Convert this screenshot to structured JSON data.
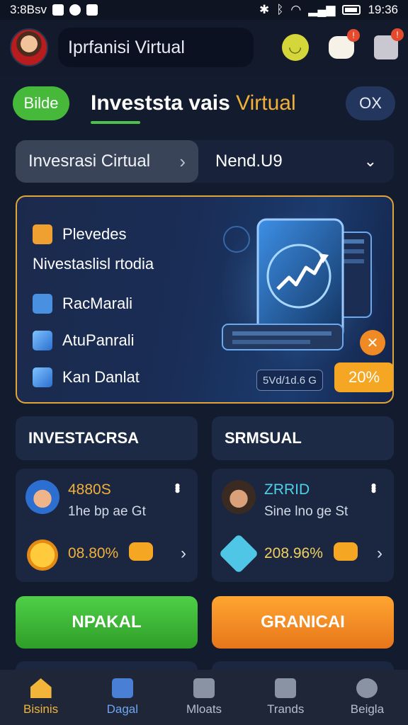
{
  "status_bar": {
    "left_text": "3:8Bsv",
    "time": "19:36"
  },
  "header": {
    "search_text": "Iprfanisi Virtual"
  },
  "title_row": {
    "pill_label": "Bilde",
    "title_main": "Investsta vais",
    "title_accent": "Virtual",
    "close_label": "OX"
  },
  "selector": {
    "left_label": "Invesrasi Cirtual",
    "left_chevron": "›",
    "right_label": "Nend.U9",
    "right_chevron": "⌄"
  },
  "hero": {
    "items": [
      {
        "label": "Plevedes",
        "icon": "tag-icon"
      },
      {
        "label": "RacMarali",
        "icon": "document-icon"
      },
      {
        "label": "AtuPanrali",
        "icon": "cube-icon"
      },
      {
        "label": "Kan Danlat",
        "icon": "cube-icon"
      }
    ],
    "subtitle": "Nivestaslisl rtodia",
    "badge_text": "5Vd/1d.6 G",
    "close_symbol": "✕",
    "percent": "20%"
  },
  "sections": {
    "left_title": "INVESTACRSA",
    "right_title": "SRMSUAL"
  },
  "stats": [
    {
      "title": "4880S",
      "sub": "1he bp ae Gt",
      "value": "08.80%",
      "avatar": "user-avatar",
      "value_icon": "coin-icon"
    },
    {
      "title": "ZRRID",
      "sub": "Sine lno ge St",
      "value": "208.96%",
      "avatar": "user-avatar",
      "value_icon": "gem-icon"
    }
  ],
  "actions": {
    "left_label": "NPAKAL",
    "right_label": "GRANICAI"
  },
  "nav": [
    {
      "label": "Bisinis",
      "icon": "home-icon"
    },
    {
      "label": "Dagal",
      "icon": "folder-icon"
    },
    {
      "label": "Mloats",
      "icon": "square-icon"
    },
    {
      "label": "Trands",
      "icon": "trophy-icon"
    },
    {
      "label": "Beigla",
      "icon": "search-icon"
    }
  ],
  "colors": {
    "background": "#131b2e",
    "accent_orange": "#f2b03a",
    "accent_green": "#46b83a",
    "hero_border": "#e0a43a"
  }
}
